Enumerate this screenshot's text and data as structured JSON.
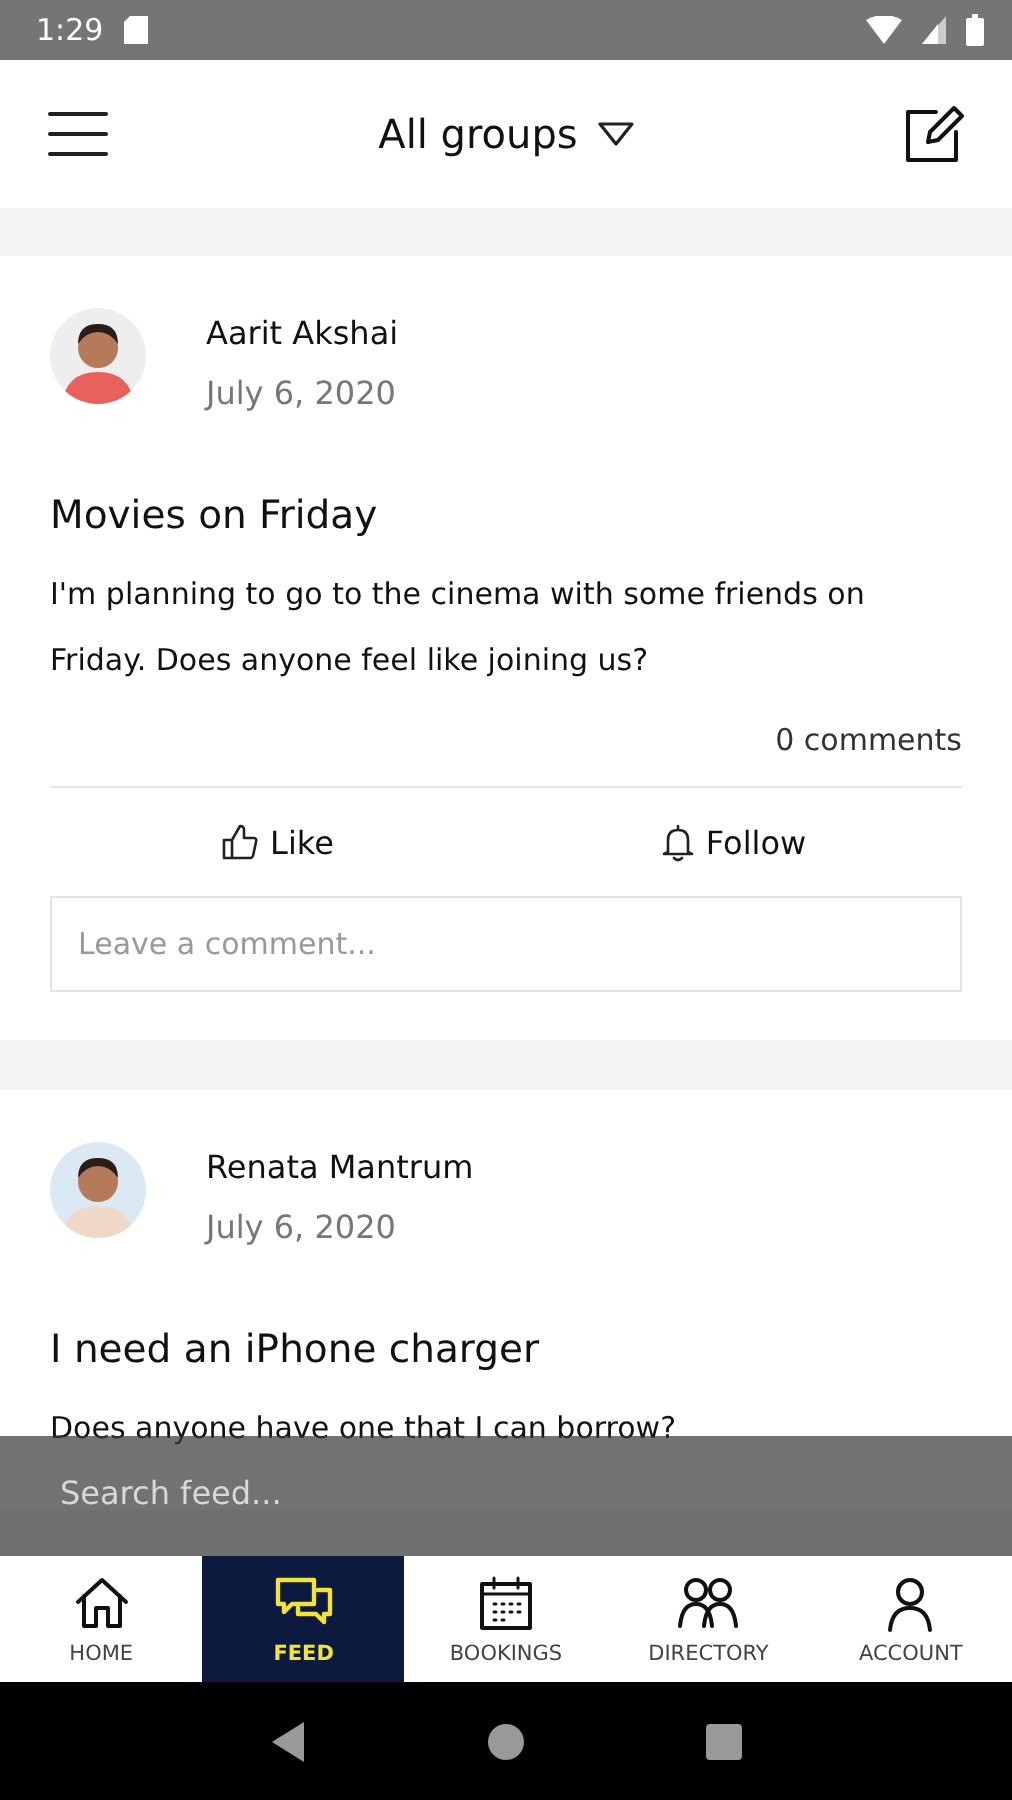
{
  "status_bar": {
    "time": "1:29"
  },
  "header": {
    "title": "All groups"
  },
  "posts": [
    {
      "author": "Aarit Akshai",
      "date": "July 6, 2020",
      "title": "Movies on Friday",
      "body": "I'm planning to go to the cinema with some friends on Friday. Does anyone feel like joining us?",
      "comments": "0 comments",
      "actions": [
        {
          "kind": "like",
          "label": "Like"
        },
        {
          "kind": "follow",
          "label": "Follow"
        }
      ],
      "comment_placeholder": "Leave a comment..."
    },
    {
      "author": "Renata Mantrum",
      "date": "July 6, 2020",
      "title": "I need an iPhone charger",
      "body": "Does anyone have one that I can borrow?"
    }
  ],
  "search": {
    "placeholder": "Search feed..."
  },
  "nav": [
    {
      "kind": "home",
      "label": "HOME",
      "selected": false
    },
    {
      "kind": "feed",
      "label": "FEED",
      "selected": true
    },
    {
      "kind": "bookings",
      "label": "BOOKINGS",
      "selected": false
    },
    {
      "kind": "directory",
      "label": "DIRECTORY",
      "selected": false
    },
    {
      "kind": "account",
      "label": "ACCOUNT",
      "selected": false
    }
  ]
}
